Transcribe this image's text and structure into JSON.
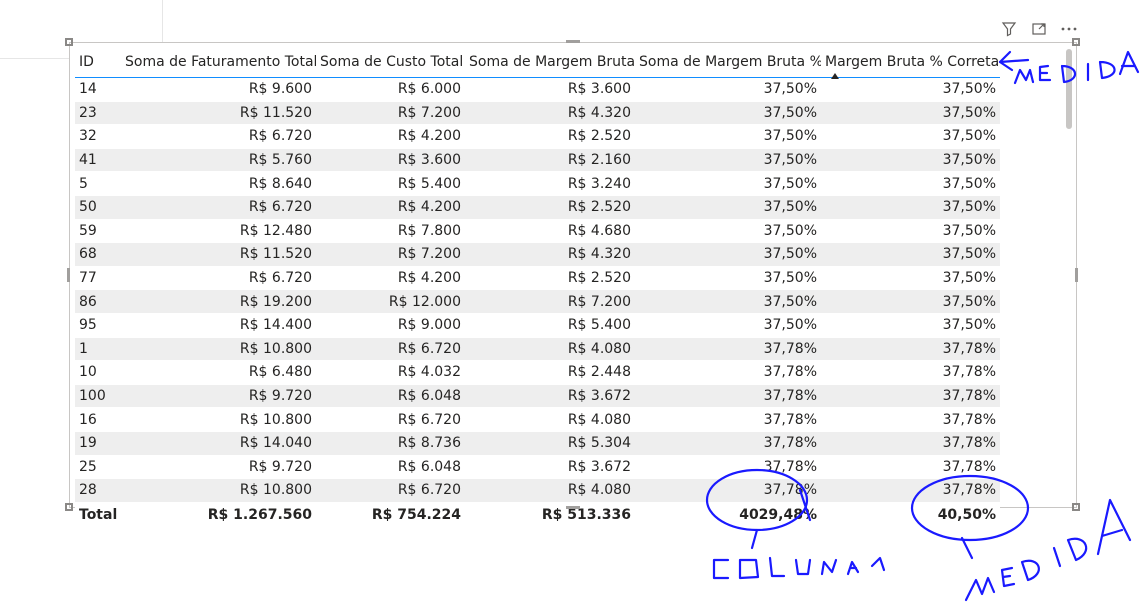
{
  "toolbar": {
    "icons": [
      "filter-icon",
      "focus-mode-icon",
      "more-options-icon"
    ]
  },
  "table": {
    "columns": [
      "ID",
      "Soma de Faturamento Total",
      "Soma de Custo Total",
      "Soma de Margem Bruta",
      "Soma de Margem Bruta %",
      "Margem Bruta % Correta"
    ],
    "rows": [
      [
        "14",
        "R$ 9.600",
        "R$ 6.000",
        "R$ 3.600",
        "37,50%",
        "37,50%"
      ],
      [
        "23",
        "R$ 11.520",
        "R$ 7.200",
        "R$ 4.320",
        "37,50%",
        "37,50%"
      ],
      [
        "32",
        "R$ 6.720",
        "R$ 4.200",
        "R$ 2.520",
        "37,50%",
        "37,50%"
      ],
      [
        "41",
        "R$ 5.760",
        "R$ 3.600",
        "R$ 2.160",
        "37,50%",
        "37,50%"
      ],
      [
        "5",
        "R$ 8.640",
        "R$ 5.400",
        "R$ 3.240",
        "37,50%",
        "37,50%"
      ],
      [
        "50",
        "R$ 6.720",
        "R$ 4.200",
        "R$ 2.520",
        "37,50%",
        "37,50%"
      ],
      [
        "59",
        "R$ 12.480",
        "R$ 7.800",
        "R$ 4.680",
        "37,50%",
        "37,50%"
      ],
      [
        "68",
        "R$ 11.520",
        "R$ 7.200",
        "R$ 4.320",
        "37,50%",
        "37,50%"
      ],
      [
        "77",
        "R$ 6.720",
        "R$ 4.200",
        "R$ 2.520",
        "37,50%",
        "37,50%"
      ],
      [
        "86",
        "R$ 19.200",
        "R$ 12.000",
        "R$ 7.200",
        "37,50%",
        "37,50%"
      ],
      [
        "95",
        "R$ 14.400",
        "R$ 9.000",
        "R$ 5.400",
        "37,50%",
        "37,50%"
      ],
      [
        "1",
        "R$ 10.800",
        "R$ 6.720",
        "R$ 4.080",
        "37,78%",
        "37,78%"
      ],
      [
        "10",
        "R$ 6.480",
        "R$ 4.032",
        "R$ 2.448",
        "37,78%",
        "37,78%"
      ],
      [
        "100",
        "R$ 9.720",
        "R$ 6.048",
        "R$ 3.672",
        "37,78%",
        "37,78%"
      ],
      [
        "16",
        "R$ 10.800",
        "R$ 6.720",
        "R$ 4.080",
        "37,78%",
        "37,78%"
      ],
      [
        "19",
        "R$ 14.040",
        "R$ 8.736",
        "R$ 5.304",
        "37,78%",
        "37,78%"
      ],
      [
        "25",
        "R$ 9.720",
        "R$ 6.048",
        "R$ 3.672",
        "37,78%",
        "37,78%"
      ],
      [
        "28",
        "R$ 10.800",
        "R$ 6.720",
        "R$ 4.080",
        "37,78%",
        "37,78%"
      ]
    ],
    "totals": [
      "Total",
      "R$ 1.267.560",
      "R$ 754.224",
      "R$ 513.336",
      "4029,48%",
      "40,50%"
    ]
  },
  "colors": {
    "accent": "#118dff",
    "ink": "#1a1aff",
    "stripe": "#eeeeee"
  }
}
